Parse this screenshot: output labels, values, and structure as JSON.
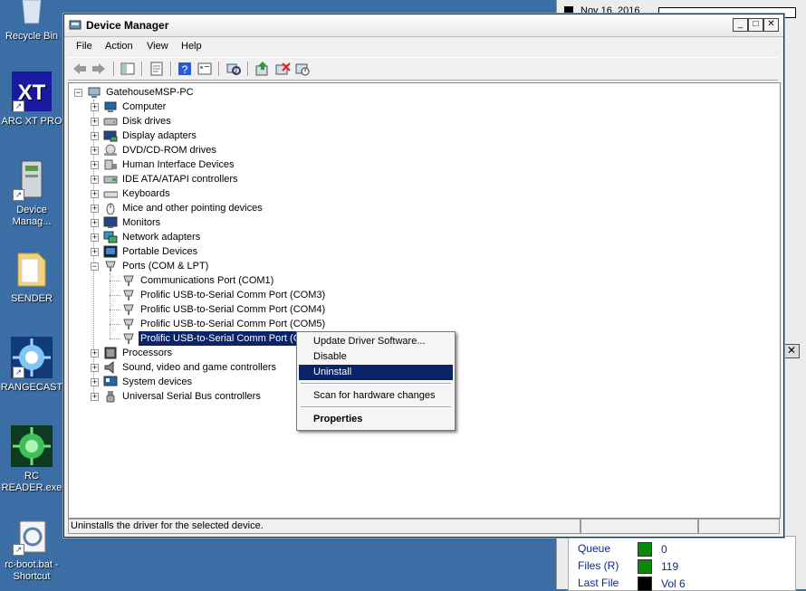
{
  "desktop": {
    "icons": [
      {
        "label": "Recycle Bin",
        "icon": "recycle-bin-icon"
      },
      {
        "label": "ARC XT PRO",
        "icon": "arc-xt-pro-icon"
      },
      {
        "label": "Device Manag...",
        "icon": "device-manager-icon"
      },
      {
        "label": "SENDER",
        "icon": "folder-icon"
      },
      {
        "label": "RANGECAST",
        "icon": "rangecast-icon"
      },
      {
        "label": "RC READER.exe",
        "icon": "rc-reader-icon"
      },
      {
        "label": "rc-boot.bat - Shortcut",
        "icon": "batch-file-icon"
      }
    ]
  },
  "background_app": {
    "date": "Nov 16, 2016",
    "rows": [
      {
        "label": "Queue",
        "value": "0",
        "led_color": "#0a8a0a"
      },
      {
        "label": "Files (R)",
        "value": "119",
        "led_color": "#0a8a0a"
      },
      {
        "label": "Last File",
        "value": "Vol 6",
        "led_color": "#000000"
      }
    ],
    "close_glyph": "✕"
  },
  "window": {
    "title": "Device Manager",
    "caption_buttons": {
      "minimize": "_",
      "maximize": "□",
      "close": "✕"
    },
    "menu": [
      "File",
      "Action",
      "View",
      "Help"
    ],
    "toolbar": [
      "back-icon",
      "forward-icon",
      "properties-pane-icon",
      "properties-icon",
      "help-icon",
      "view-icon",
      "scan-hardware-icon",
      "update-driver-icon",
      "uninstall-icon",
      "disable-icon"
    ],
    "tree": {
      "root": "GatehouseMSP-PC",
      "categories": [
        {
          "label": "Computer",
          "icon": "computer-icon"
        },
        {
          "label": "Disk drives",
          "icon": "disk-drive-icon"
        },
        {
          "label": "Display adapters",
          "icon": "display-adapter-icon"
        },
        {
          "label": "DVD/CD-ROM drives",
          "icon": "dvd-drive-icon"
        },
        {
          "label": "Human Interface Devices",
          "icon": "hid-icon"
        },
        {
          "label": "IDE ATA/ATAPI controllers",
          "icon": "ide-controller-icon"
        },
        {
          "label": "Keyboards",
          "icon": "keyboard-icon"
        },
        {
          "label": "Mice and other pointing devices",
          "icon": "mouse-icon"
        },
        {
          "label": "Monitors",
          "icon": "monitor-icon"
        },
        {
          "label": "Network adapters",
          "icon": "network-adapter-icon"
        },
        {
          "label": "Portable Devices",
          "icon": "portable-device-icon"
        },
        {
          "label": "Ports (COM & LPT)",
          "icon": "port-icon",
          "expanded": true
        }
      ],
      "ports": [
        "Communications Port (COM1)",
        "Prolific USB-to-Serial Comm Port (COM3)",
        "Prolific USB-to-Serial Comm Port (COM4)",
        "Prolific USB-to-Serial Comm Port (COM5)",
        "Prolific USB-to-Serial Comm Port (CO"
      ],
      "after": [
        {
          "label": "Processors",
          "icon": "processor-icon"
        },
        {
          "label": "Sound, video and game controllers",
          "icon": "sound-icon"
        },
        {
          "label": "System devices",
          "icon": "system-device-icon"
        },
        {
          "label": "Universal Serial Bus controllers",
          "icon": "usb-icon"
        }
      ]
    },
    "status": "Uninstalls the driver for the selected device."
  },
  "context_menu": {
    "items": [
      "Update Driver Software...",
      "Disable",
      "Uninstall",
      "Scan for hardware changes",
      "Properties"
    ],
    "highlighted": "Uninstall"
  },
  "colors": {
    "selection": "#0a246a",
    "desktop": "#3a6ea5"
  }
}
